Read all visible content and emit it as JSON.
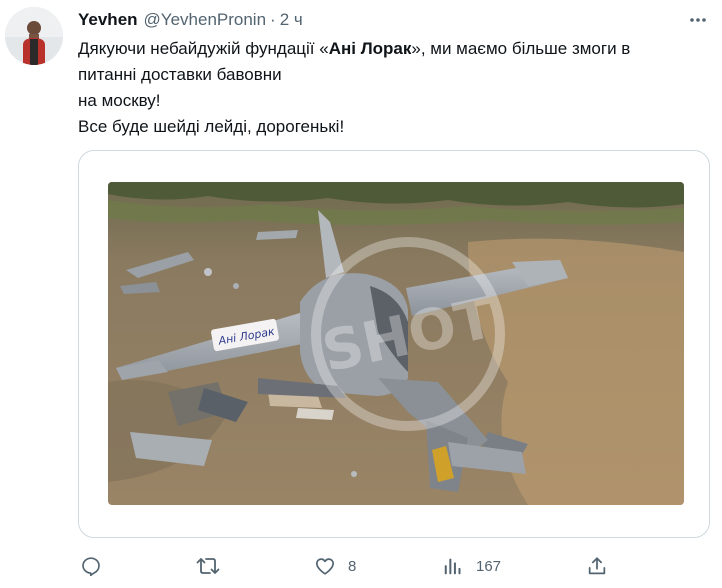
{
  "tweet": {
    "author_name": "Yevhen",
    "author_handle": "@YevhenPronin",
    "separator": "·",
    "time": "2 ч",
    "text": {
      "line1_pre": "Дякуючи небайдужій фундації «",
      "line1_bold": "Ані Лорак",
      "line1_post": "», ми маємо більше змоги в",
      "line2": "питанні доставки бавовни",
      "line3": "на москву!",
      "line4": "Все буде шейді лейді, дорогенькі!"
    },
    "photo": {
      "wing_sticker": "Ані Лорак",
      "watermark": "SHOT"
    },
    "actions": {
      "reply": {
        "icon": "reply-icon",
        "count": ""
      },
      "retweet": {
        "icon": "retweet-icon",
        "count": ""
      },
      "like": {
        "icon": "heart-icon",
        "count": "8"
      },
      "views": {
        "icon": "views-icon",
        "count": "167"
      },
      "share": {
        "icon": "share-icon",
        "count": ""
      }
    }
  },
  "colors": {
    "text_primary": "#0f1419",
    "text_secondary": "#536471",
    "border": "#cfd9de"
  }
}
